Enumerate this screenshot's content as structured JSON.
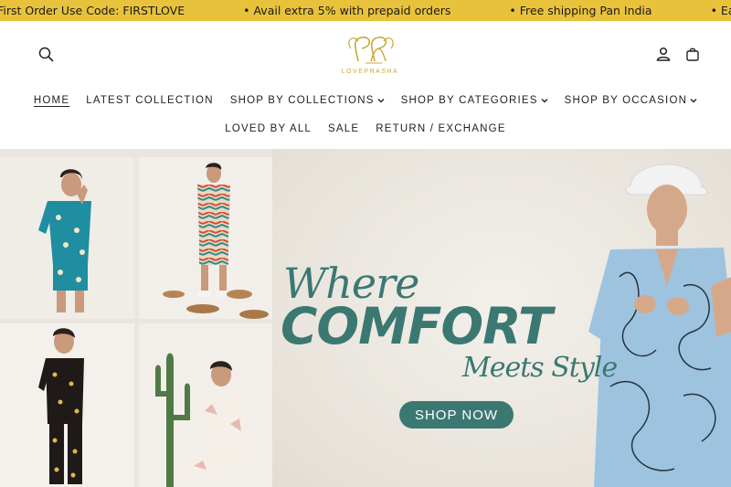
{
  "announcement": {
    "items": [
      "r First Order Use Code: FIRSTLOVE",
      "• Avail extra 5% with prepaid orders",
      "• Free shipping Pan India",
      "• Easy Exchan"
    ]
  },
  "header": {
    "logo_text": "LOVEPRASHA",
    "icons": {
      "search": "search-icon",
      "account": "user-icon",
      "cart": "bag-icon"
    }
  },
  "nav": {
    "row1": [
      {
        "label": "HOME",
        "active": true,
        "dropdown": false
      },
      {
        "label": "LATEST COLLECTION",
        "active": false,
        "dropdown": false
      },
      {
        "label": "SHOP BY COLLECTIONS",
        "active": false,
        "dropdown": true
      },
      {
        "label": "SHOP BY CATEGORIES",
        "active": false,
        "dropdown": true
      },
      {
        "label": "SHOP BY OCCASION",
        "active": false,
        "dropdown": true
      }
    ],
    "row2": [
      {
        "label": "LOVED BY ALL",
        "active": false,
        "dropdown": false
      },
      {
        "label": "SALE",
        "active": false,
        "dropdown": false
      },
      {
        "label": "RETURN / EXCHANGE",
        "active": false,
        "dropdown": false
      }
    ]
  },
  "hero": {
    "line1": "Where",
    "line2": "COMFORT",
    "line3": "Meets Style",
    "cta": "SHOP NOW"
  },
  "colors": {
    "announcement_bg": "#e8c23a",
    "brand_teal": "#3b7872",
    "logo_gold": "#c9a83a"
  }
}
